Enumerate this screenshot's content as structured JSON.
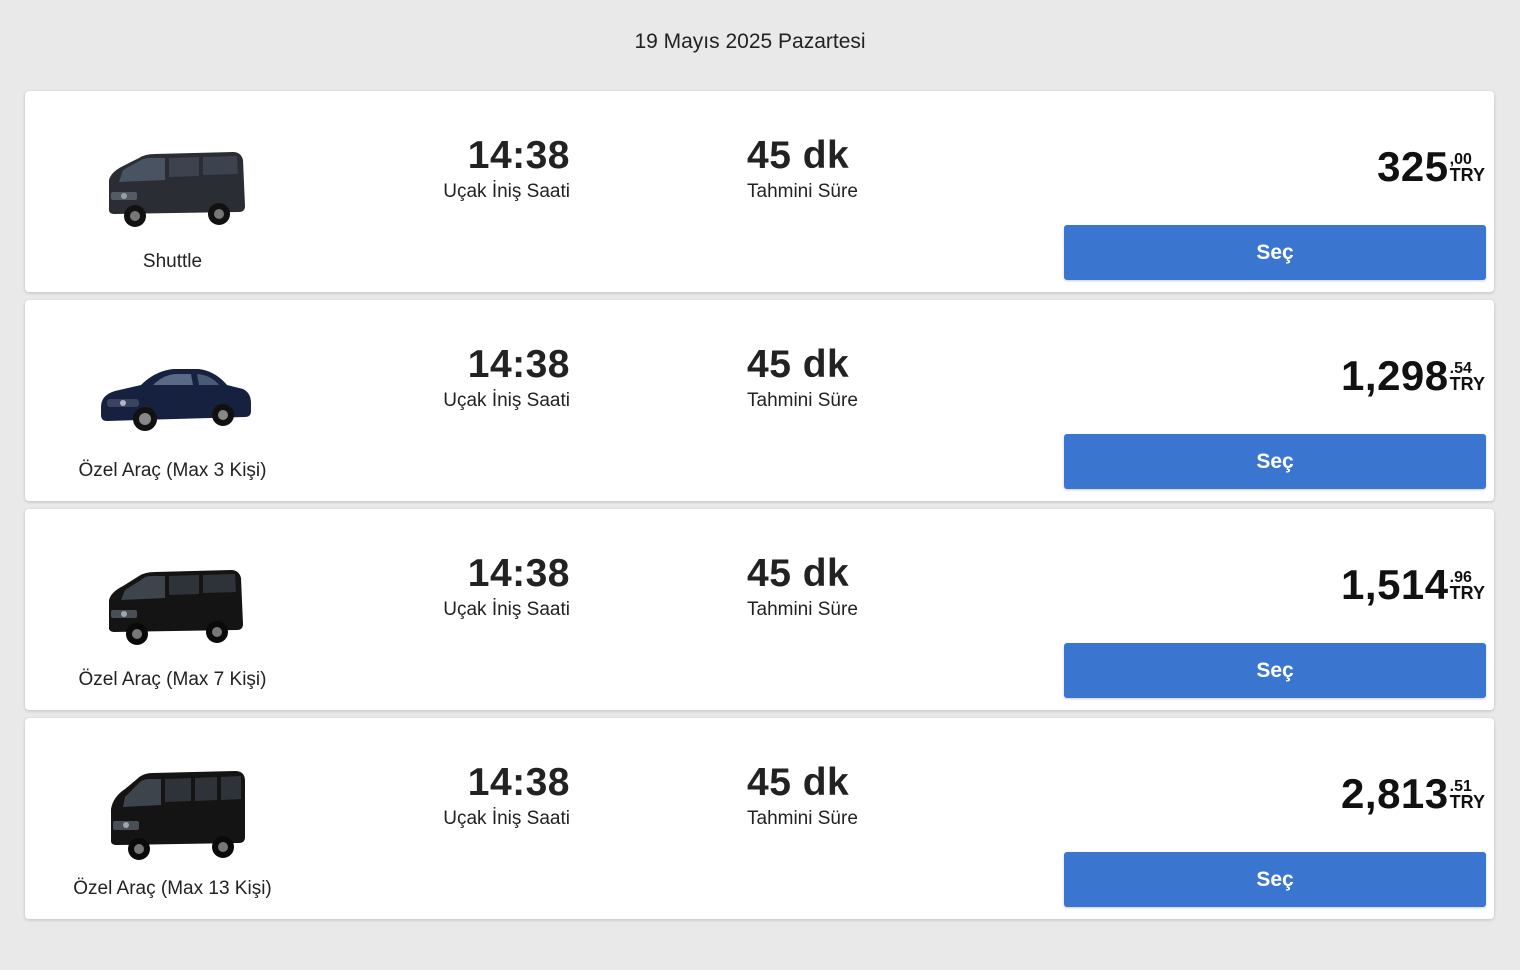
{
  "date_header": "19 Mayıs 2025 Pazartesi",
  "colors": {
    "button": "#3a76d0",
    "background": "#e9e9e9",
    "card": "#ffffff"
  },
  "offers": [
    {
      "vehicle_name": "Shuttle",
      "vehicle_icon": "van-icon",
      "landing_time": "14:38",
      "landing_label": "Uçak İniş Saati",
      "duration": "45 dk",
      "duration_label": "Tahmini Süre",
      "price_main": "325",
      "price_cents": ",00",
      "currency": "TRY",
      "button_label": "Seç"
    },
    {
      "vehicle_name": "Özel Araç (Max 3 Kişi)",
      "vehicle_icon": "sedan-icon",
      "landing_time": "14:38",
      "landing_label": "Uçak İniş Saati",
      "duration": "45 dk",
      "duration_label": "Tahmini Süre",
      "price_main": "1,298",
      "price_cents": ".54",
      "currency": "TRY",
      "button_label": "Seç"
    },
    {
      "vehicle_name": "Özel Araç (Max 7 Kişi)",
      "vehicle_icon": "van-icon",
      "landing_time": "14:38",
      "landing_label": "Uçak İniş Saati",
      "duration": "45 dk",
      "duration_label": "Tahmini Süre",
      "price_main": "1,514",
      "price_cents": ".96",
      "currency": "TRY",
      "button_label": "Seç"
    },
    {
      "vehicle_name": "Özel Araç (Max 13 Kişi)",
      "vehicle_icon": "minibus-icon",
      "landing_time": "14:38",
      "landing_label": "Uçak İniş Saati",
      "duration": "45 dk",
      "duration_label": "Tahmini Süre",
      "price_main": "2,813",
      "price_cents": ".51",
      "currency": "TRY",
      "button_label": "Seç"
    }
  ]
}
